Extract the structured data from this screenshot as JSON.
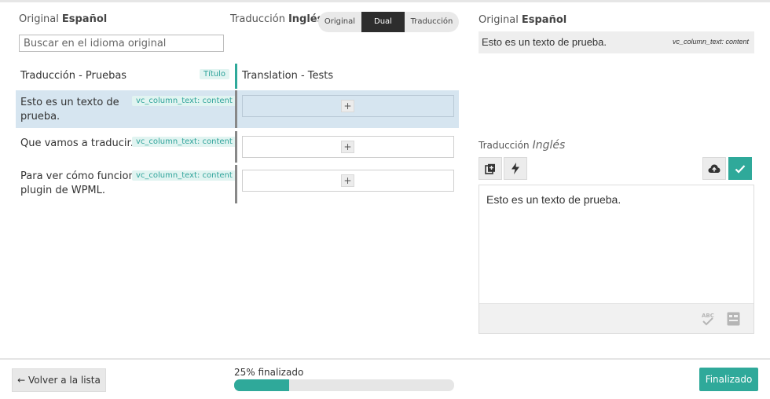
{
  "header": {
    "original_label": "Original",
    "original_lang": "Español",
    "translation_label": "Traducción",
    "translation_lang": "Inglés",
    "view_modes": [
      "Original",
      "Dual",
      "Traducción"
    ],
    "active_view": "Dual"
  },
  "search": {
    "placeholder": "Buscar en el idioma original",
    "value": ""
  },
  "rows": [
    {
      "source": "Traducción - Pruebas",
      "tag": "Título",
      "translation": "Translation - Tests",
      "selected": false
    },
    {
      "source": "Esto es un texto de prueba.",
      "tag": "vc_column_text: content",
      "translation": "",
      "selected": true
    },
    {
      "source": "Que vamos a traducir.",
      "tag": "vc_column_text: content",
      "translation": "",
      "selected": false
    },
    {
      "source": "Para ver cómo funciona el plugin de WPML.",
      "tag": "vc_column_text: content",
      "translation": "",
      "selected": false
    }
  ],
  "add_glyph": "+",
  "panel": {
    "original_label": "Original",
    "original_lang": "Español",
    "original_text": "Esto es un texto de prueba.",
    "field_name": "vc_column_text: content",
    "translation_label": "Traducción",
    "translation_lang": "Inglés",
    "editor_text": "Esto es un texto de prueba.",
    "icons": [
      "copy-icon",
      "bolt-icon",
      "cloud-upload-icon",
      "check-icon",
      "spellcheck-icon",
      "glossary-icon"
    ]
  },
  "footer": {
    "back_label": "← Volver a la lista",
    "progress_label": "25% finalizado",
    "progress": 0.25,
    "done_label": "Finalizado"
  },
  "colors": {
    "accent": "#2fa99a",
    "selected_row": "#d6e5f0",
    "dark_toggle": "#2d2d2d"
  }
}
